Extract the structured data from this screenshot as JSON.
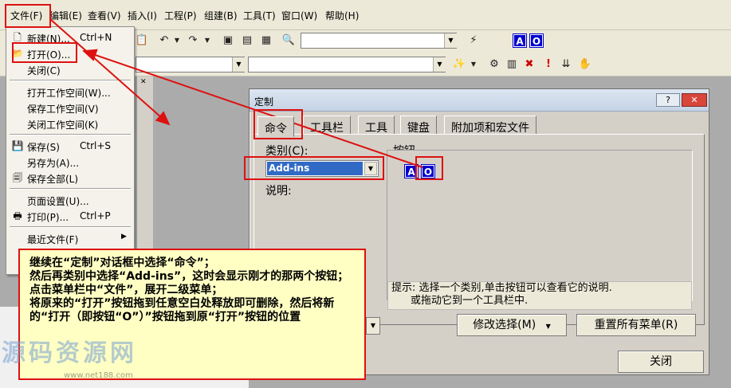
{
  "menubar": {
    "items": [
      {
        "label": "文件(F)"
      },
      {
        "label": "编辑(E)"
      },
      {
        "label": "查看(V)"
      },
      {
        "label": "插入(I)"
      },
      {
        "label": "工程(P)"
      },
      {
        "label": "组建(B)"
      },
      {
        "label": "工具(T)"
      },
      {
        "label": "窗口(W)"
      },
      {
        "label": "帮助(H)"
      }
    ]
  },
  "toolbar": {
    "combo_value_1": "",
    "combo_value_2": "",
    "combo_value_3": "",
    "blue_buttons": [
      "A",
      "O"
    ]
  },
  "file_menu": {
    "new_label": "新建(N)...",
    "new_shortcut": "Ctrl+N",
    "open_label": "打开(O)...",
    "close_label": "关闭(C)",
    "open_ws_label": "打开工作空间(W)...",
    "save_ws_label": "保存工作空间(V)",
    "close_ws_label": "关闭工作空间(K)",
    "save_label": "保存(S)",
    "save_shortcut": "Ctrl+S",
    "save_as_label": "另存为(A)...",
    "save_all_label": "保存全部(L)",
    "page_setup_label": "页面设置(U)...",
    "print_label": "打印(P)...",
    "print_shortcut": "Ctrl+P",
    "recent_label": "最近文件(F)"
  },
  "dialog": {
    "title": "定制",
    "help_btn": "?",
    "close_btn": "✕",
    "tabs": [
      {
        "label": "命令"
      },
      {
        "label": "工具栏"
      },
      {
        "label": "工具"
      },
      {
        "label": "键盘"
      },
      {
        "label": "附加项和宏文件"
      }
    ],
    "category_label": "类别(C):",
    "category_value": "Add-ins",
    "buttons_label": "按钮",
    "description_label": "说明:",
    "button_icons": [
      "A",
      "O"
    ],
    "hint_line1": "提示: 选择一个类别,单击按钮可以查看它的说明.",
    "hint_line2": "或拖动它到一个工具栏中.",
    "modify_btn": "修改选择(M)",
    "reset_btn": "重置所有菜单(R)",
    "close_btn_label": "关闭"
  },
  "note": {
    "line1": "继续在“定制”对话框中选择“命令”；",
    "line2": "然后再类别中选择“Add-ins”，这时会显示刚才的那两个按钮；",
    "line3": "点击菜单栏中“文件”，展开二级菜单；",
    "line4": "将原来的“打开”按钮拖到任意空白处释放即可删除，然后将新的“打开（即按钮“O”）”按钮拖到原“打开”按钮的位置"
  },
  "watermark": {
    "text": "源码资源网",
    "url": "www.net188.com"
  },
  "colors": {
    "annotation_red": "#dd1111",
    "note_bg": "#ffffc4",
    "blue_button": "#0000cc",
    "selection_blue": "#316ac5"
  }
}
